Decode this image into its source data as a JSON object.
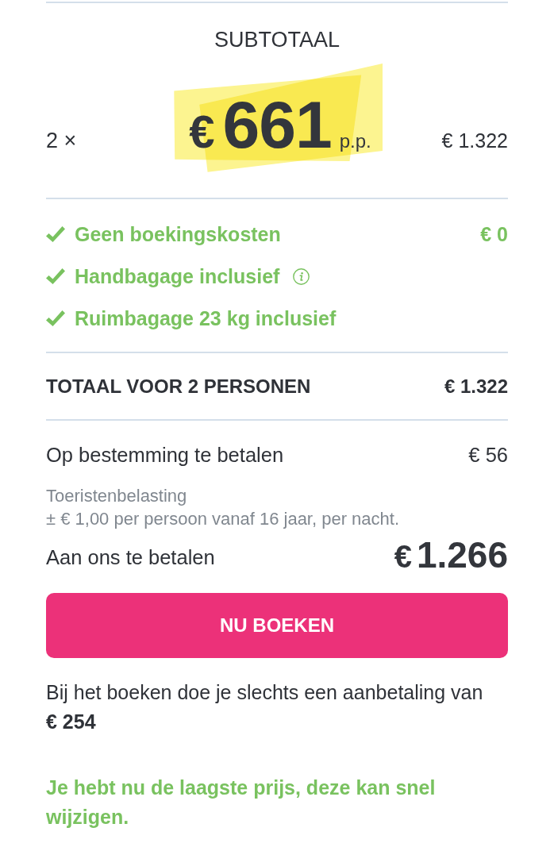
{
  "subtotal": {
    "title": "SUBTOTAAL",
    "quantity": "2 ×",
    "currency": "€",
    "price": "661",
    "unit": "p.p.",
    "amount": "€ 1.322"
  },
  "inclusions": [
    {
      "label": "Geen boekingskosten",
      "info": false,
      "amount": "€ 0"
    },
    {
      "label": "Handbagage inclusief",
      "info": true
    },
    {
      "label": "Ruimbagage 23 kg inclusief",
      "info": false
    }
  ],
  "total": {
    "label": "TOTAAL VOOR 2 PERSONEN",
    "amount": "€ 1.322"
  },
  "on_destination": {
    "label": "Op bestemming te betalen",
    "amount": "€ 56",
    "tax_title": "Toeristenbelasting",
    "tax_note": "± € 1,00 per persoon vanaf 16 jaar, per nacht."
  },
  "to_pay": {
    "label": "Aan ons te betalen",
    "currency": "€",
    "amount": "1.266"
  },
  "book_button": {
    "label": "NU BOEKEN"
  },
  "deposit_note": "Bij het boeken doe je slechts een aanbetaling van **€ 254**",
  "price_notice": "Je hebt nu de laagste prijs, deze kan snel wijzigen."
}
